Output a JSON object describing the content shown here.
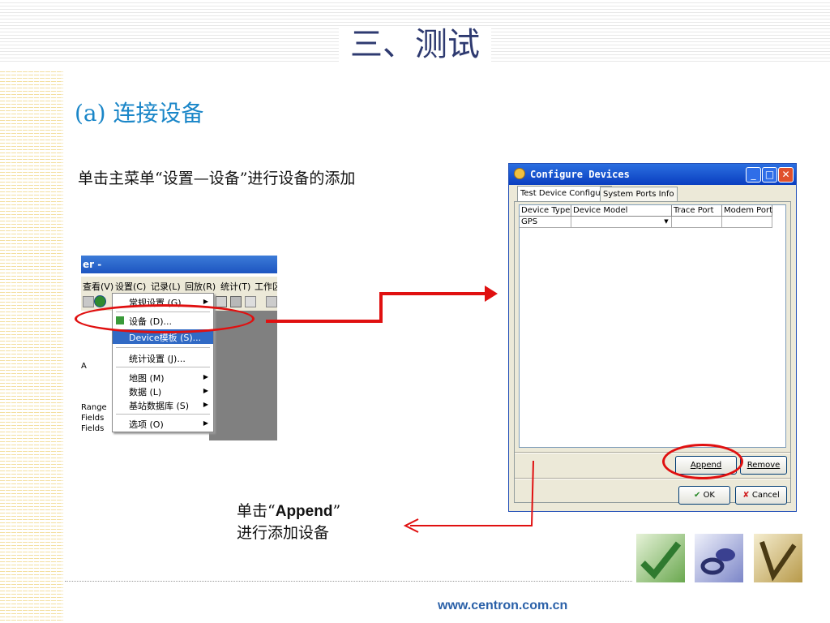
{
  "slide": {
    "title": "三、测试",
    "subtitle": "(a) 连接设备",
    "instruction": "单击主菜单“设置—设备”进行设备的添加",
    "note_line1_prefix": "单击“",
    "note_line1_bold": "Append",
    "note_line1_suffix": "”",
    "note_line2": "进行添加设备",
    "footer_url": "www.centron.com.cn",
    "accent_color": "#e01010",
    "title_color": "#2e3a70",
    "subtitle_color": "#1a86c8"
  },
  "app_crop": {
    "title_fragment": "er -",
    "menubar": [
      "查看(V)",
      "设置(C)",
      "记录(L)",
      "回放(R)",
      "统计(T)",
      "工作区"
    ],
    "left_labels": [
      "A",
      "Range",
      "Fields",
      "Fields"
    ],
    "dropdown": {
      "items": [
        {
          "label": "常规设置 (G)",
          "submenu": true
        },
        {
          "label": "设备 (D)...",
          "submenu": false
        },
        {
          "label": "Device模板 (S)...",
          "submenu": false,
          "highlighted": true
        },
        {
          "label": "统计设置 (J)...",
          "submenu": false
        },
        {
          "label": "地图 (M)",
          "submenu": true
        },
        {
          "label": "数据 (L)",
          "submenu": true
        },
        {
          "label": "基站数据库 (S)",
          "submenu": true
        },
        {
          "label": "选项 (O)",
          "submenu": true
        }
      ]
    }
  },
  "dialog": {
    "title": "Configure Devices",
    "tabs": [
      "Test Device Configure",
      "System Ports Info"
    ],
    "columns": [
      "Device Type",
      "Device Model",
      "Trace Port",
      "Modem Port"
    ],
    "rows": [
      {
        "device_type": "GPS",
        "device_model": "",
        "trace_port": "",
        "modem_port": ""
      }
    ],
    "buttons": {
      "append": "Append",
      "remove": "Remove",
      "ok": "OK",
      "cancel": "Cancel"
    }
  }
}
